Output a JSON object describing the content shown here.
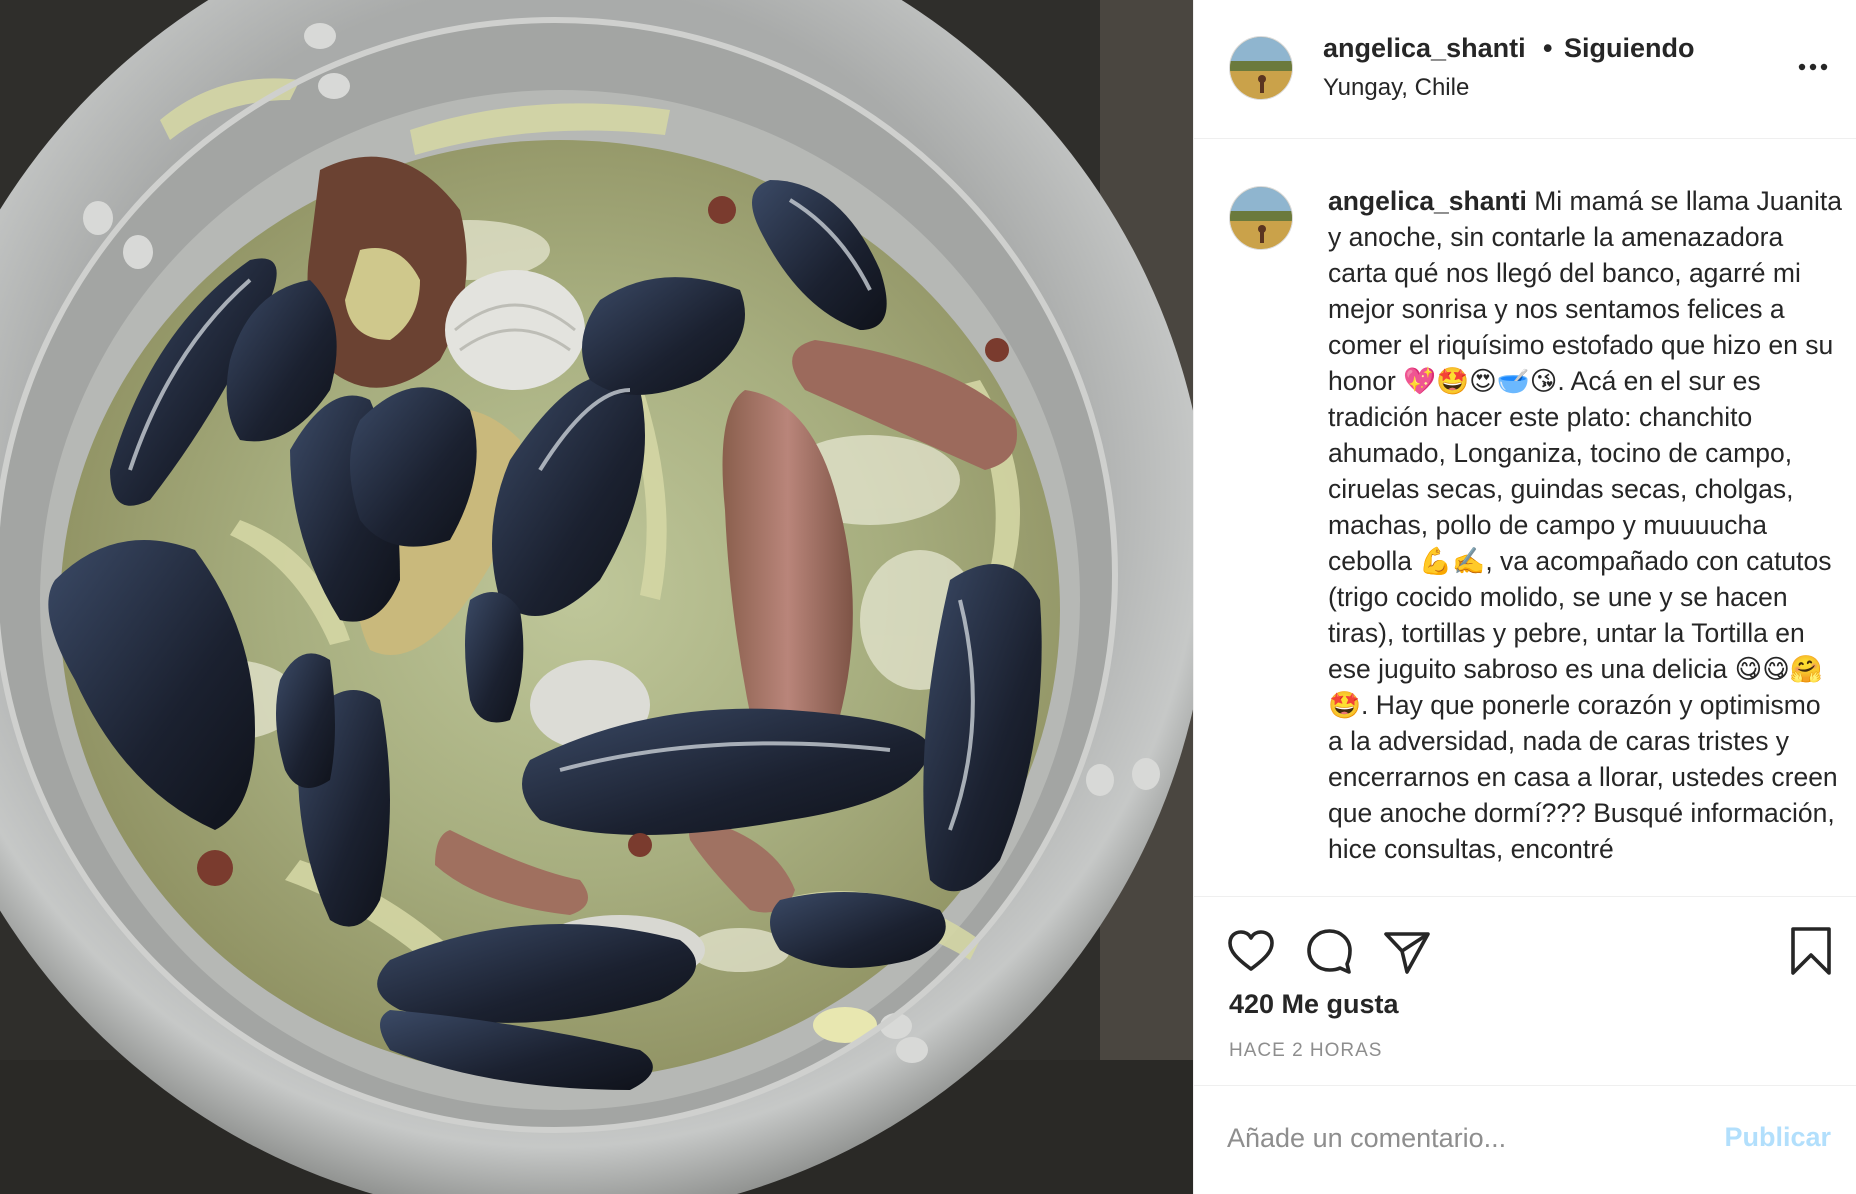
{
  "post": {
    "username": "angelica_shanti",
    "separator": "•",
    "follow_status": "Siguiendo",
    "location": "Yungay, Chile"
  },
  "caption": {
    "username": "angelica_shanti",
    "text": " Mi mamá se llama Juanita y anoche, sin contarle la amenazadora carta qué nos llegó del banco, agarré mi mejor sonrisa y nos sentamos felices a comer el riquísimo estofado que hizo en su honor 💖🤩😍🥣😘. Acá en el sur es tradición hacer este plato: chanchito ahumado, Longaniza, tocino de campo, ciruelas secas, guindas secas, cholgas, machas, pollo de campo y muuuucha cebolla 💪✍️, va acompañado con catutos (trigo cocido molido, se une y se hacen tiras), tortillas y pebre, untar la Tortilla en ese juguito sabroso es una delicia 😋😋🤗🤩. Hay que ponerle corazón y optimismo a la adversidad, nada de caras tristes y encerrarnos en casa a llorar, ustedes creen que anoche dormí??? Busqué información, hice consultas, encontré"
  },
  "stats": {
    "likes": "420 Me gusta",
    "time_ago": "HACE 2 HORAS"
  },
  "comment_box": {
    "placeholder": "Añade un comentario...",
    "publish_label": "Publicar"
  },
  "icons": {
    "more": "more-options-icon",
    "like": "heart-icon",
    "comment": "comment-icon",
    "share": "send-icon",
    "save": "bookmark-icon"
  },
  "colors": {
    "text": "#262626",
    "secondary": "#8e8e8e",
    "publish_disabled": "#b2dffc",
    "divider": "#efefef"
  }
}
